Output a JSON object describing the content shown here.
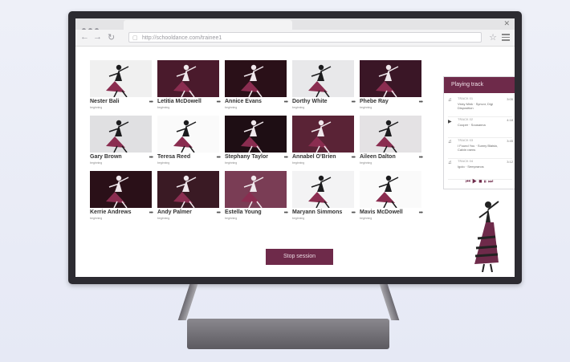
{
  "browser": {
    "url": "http://schooldance.com/trainee1"
  },
  "students": [
    {
      "name": "Nester Bali",
      "level": "beginning",
      "bg": "#f0f0f0"
    },
    {
      "name": "Letitia McDowell",
      "level": "beginning",
      "bg": "#4a1a2c"
    },
    {
      "name": "Annice Evans",
      "level": "beginning",
      "bg": "#2a1018"
    },
    {
      "name": "Dorthy White",
      "level": "beginning",
      "bg": "#e8e8ea"
    },
    {
      "name": "Phebe Ray",
      "level": "beginning",
      "bg": "#3a1626"
    },
    {
      "name": "Gary Brown",
      "level": "beginning",
      "bg": "#e0e0e2"
    },
    {
      "name": "Teresa Reed",
      "level": "beginning",
      "bg": "#fafafa"
    },
    {
      "name": "Stephany Taylor",
      "level": "beginning",
      "bg": "#1e0e14"
    },
    {
      "name": "Annabel O'Brien",
      "level": "beginning",
      "bg": "#5a2336"
    },
    {
      "name": "Aileen Dalton",
      "level": "beginning",
      "bg": "#e4e2e4"
    },
    {
      "name": "Kerrie Andrews",
      "level": "beginning",
      "bg": "#2a1018"
    },
    {
      "name": "Andy Palmer",
      "level": "beginning",
      "bg": "#3a1a24"
    },
    {
      "name": "Estella Young",
      "level": "beginning",
      "bg": "#7a3d55"
    },
    {
      "name": "Maryann Simmons",
      "level": "beginning",
      "bg": "#f3f3f4"
    },
    {
      "name": "Mavis McDowell",
      "level": "beginning",
      "bg": "#fafafa"
    }
  ],
  "actions": {
    "stop_session": "Stop session"
  },
  "playlist": {
    "title": "Playing track",
    "tracks": [
      {
        "num": "TRACK 01",
        "title": "Vicky Mink · Synvor, Digi Disposition",
        "duration": "3:05",
        "icon": "music-note-icon"
      },
      {
        "num": "TRACK 02",
        "title": "Cooper · Sousanna",
        "duration": "4:18",
        "icon": "play-icon"
      },
      {
        "num": "TRACK 03",
        "title": "I Found You · Sunny Blaisio, Calvin raens",
        "duration": "3:45",
        "icon": "music-note-icon"
      },
      {
        "num": "TRACK 04",
        "title": "Igolo · Sempranos",
        "duration": "3:12",
        "icon": "music-note-icon"
      }
    ],
    "accent": "#6e2a4a"
  }
}
